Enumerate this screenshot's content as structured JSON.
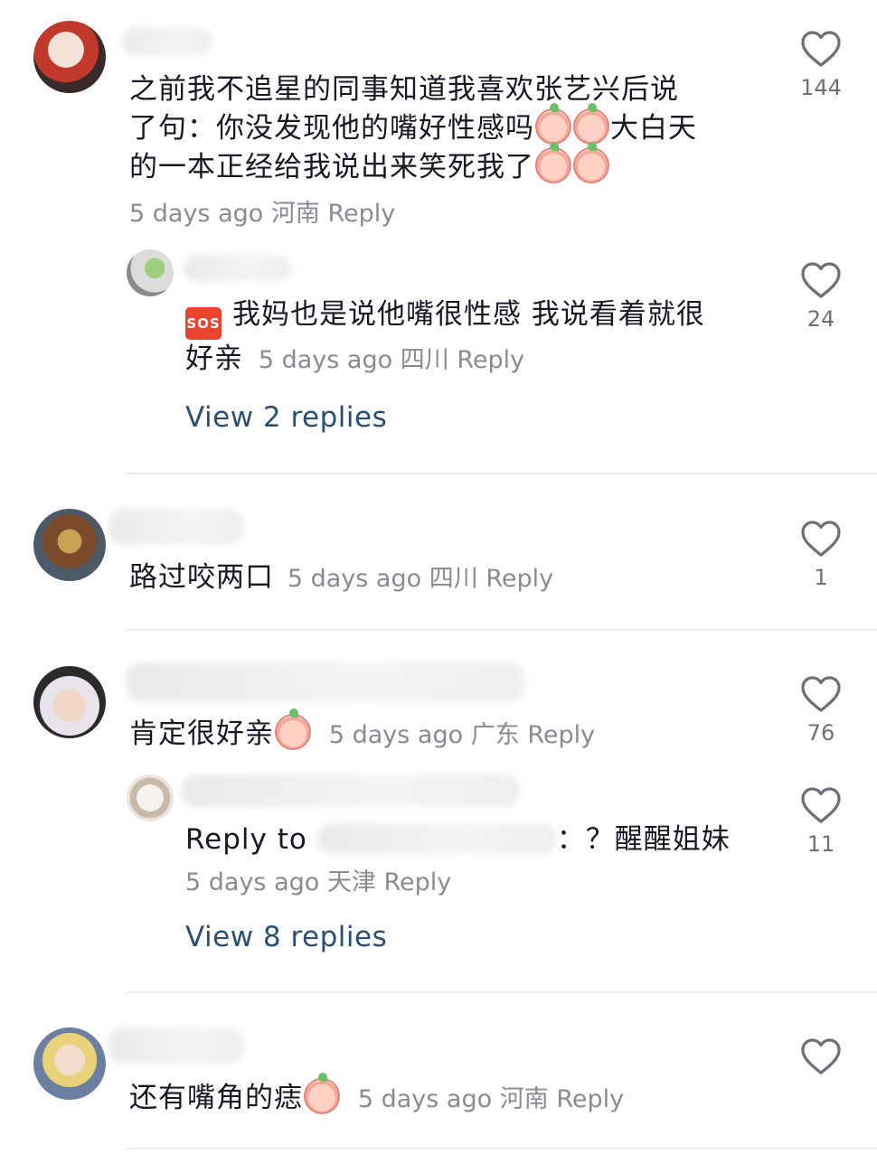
{
  "comments": [
    {
      "text": "之前我不追星的同事知道我喜欢张艺兴后说了句：你没发现他的嘴好性感吗",
      "text_line1": "之前我不追星的同事知道我喜欢张艺兴后说",
      "text_line2a": "了句：你没发现他的嘴好性感吗",
      "text_line2b": "大白天",
      "text_line3": "的一本正经给我说出来笑死我了",
      "time": "5 days ago",
      "location": "河南",
      "reply_label": "Reply",
      "likes": "144"
    },
    {
      "text_line1": "我妈也是说他嘴很性感 我说看着就很",
      "text_line2": "好亲",
      "emoji_badge": "SOS",
      "time": "5 days ago",
      "location": "四川",
      "reply_label": "Reply",
      "likes": "24",
      "view_replies": "View 2 replies"
    },
    {
      "text": "路过咬两口",
      "time": "5 days ago",
      "location": "四川",
      "reply_label": "Reply",
      "likes": "1"
    },
    {
      "text": "肯定很好亲",
      "time": "5 days ago",
      "location": "广东",
      "reply_label": "Reply",
      "likes": "76"
    },
    {
      "reply_to_label": "Reply to",
      "text": "：？醒醒姐妹",
      "time": "5 days ago",
      "location": "天津",
      "reply_label": "Reply",
      "likes": "11",
      "view_replies": "View 8 replies"
    },
    {
      "text": "还有嘴角的痣",
      "time": "5 days ago",
      "location": "河南",
      "reply_label": "Reply",
      "likes": ""
    }
  ],
  "icons": {
    "like": "heart-outline-icon",
    "emoji": "peach-face-emoji-icon"
  },
  "colors": {
    "text": "#161823",
    "meta": "#8a8b91",
    "link": "#2b4f73",
    "divider": "#ececee"
  }
}
